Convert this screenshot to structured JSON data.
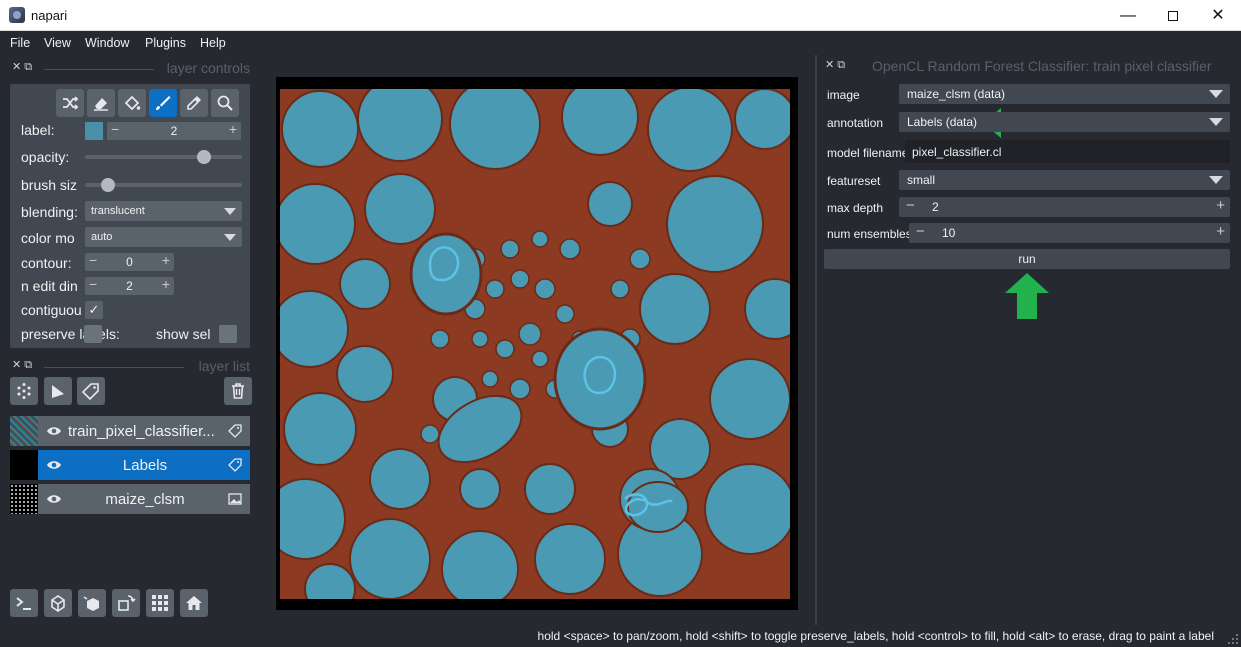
{
  "window": {
    "title": "napari"
  },
  "menu": [
    "File",
    "View",
    "Window",
    "Plugins",
    "Help"
  ],
  "left_dock": {
    "controls_title": "layer controls",
    "list_title": "layer list",
    "dock_buttons": "✕ ⧉"
  },
  "layer_controls": {
    "label_label": "label:",
    "label_value": "2",
    "opacity_label": "opacity:",
    "opacity_value": 0.78,
    "brush_label": "brush siz",
    "brush_value": 0.11,
    "blending_label": "blending:",
    "blending_value": "translucent",
    "color_mode_label": "color mo",
    "color_mode_value": "auto",
    "contour_label": "contour:",
    "contour_value": "0",
    "n_edit_label": "n edit din",
    "n_edit_value": "2",
    "contiguous_label": "contiguou",
    "preserve_label": "preserve labels:",
    "show_selected_label": "show sel",
    "spin_minus": "−",
    "spin_plus": "+",
    "check_mark": "✓"
  },
  "layers": [
    {
      "name": "train_pixel_classifier...",
      "type": "labels",
      "selected": false
    },
    {
      "name": "Labels",
      "type": "labels",
      "selected": true
    },
    {
      "name": "maize_clsm",
      "type": "image",
      "selected": false
    }
  ],
  "plugin": {
    "title": "OpenCL Random Forest Classifier: train pixel classifier",
    "image_label": "image",
    "image_value": "maize_clsm (data)",
    "annotation_label": "annotation",
    "annotation_value": "Labels (data)",
    "model_label": "model filename",
    "model_value": "pixel_classifier.cl",
    "featureset_label": "featureset",
    "featureset_value": "small",
    "max_depth_label": "max depth",
    "max_depth_value": "2",
    "num_ensembles_label": "num ensembles",
    "num_ensembles_value": "10",
    "run_label": "run"
  },
  "status": {
    "text": "hold <space> to pan/zoom, hold <shift> to toggle preserve_labels, hold <control> to fill, hold <alt> to erase, drag to paint a label"
  },
  "colors": {
    "accent": "#0d6fc4",
    "arrow": "#22b14c",
    "label_blue": "#4a9ab3",
    "label_brown": "#8c3a22"
  }
}
